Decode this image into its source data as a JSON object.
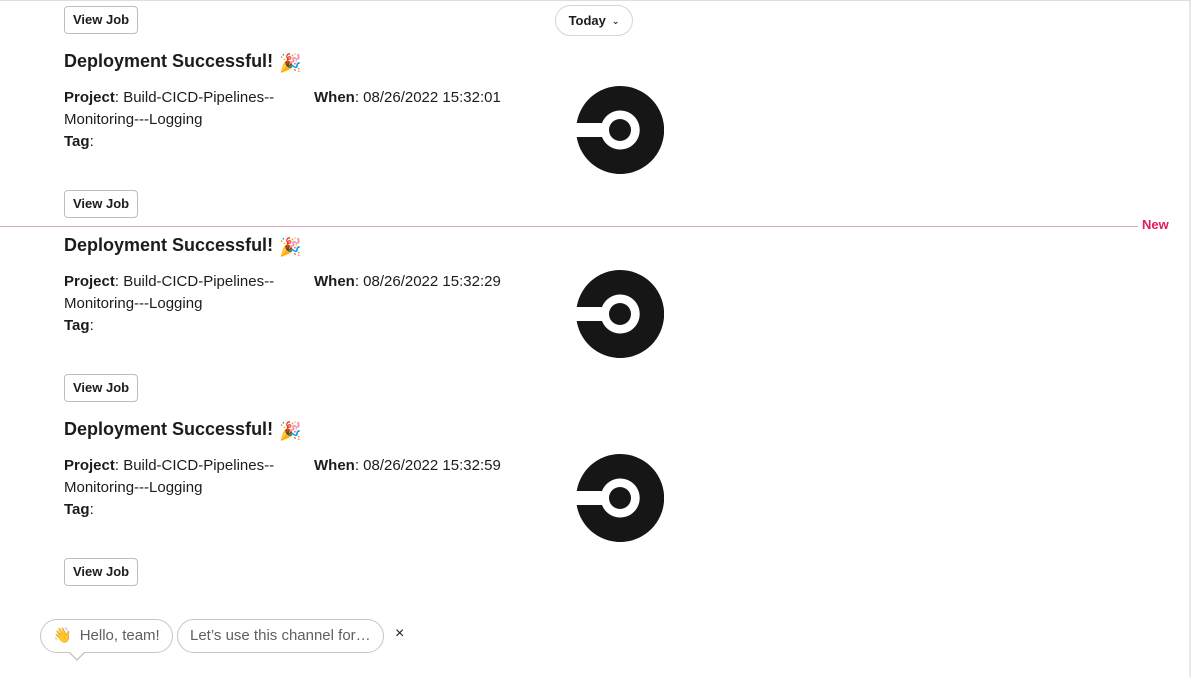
{
  "top": {
    "view_job_label": "View Job",
    "date_pill_label": "Today"
  },
  "messages": [
    {
      "title": "Deployment Successful!",
      "emoji": "🎉",
      "project_label": "Project",
      "project_value": "Build-CICD-Pipelines--Monitoring---Logging",
      "tag_label": "Tag",
      "tag_value": "",
      "when_label": "When",
      "when_value": "08/26/2022 15:32:01",
      "button_label": "View Job"
    },
    {
      "title": "Deployment Successful!",
      "emoji": "🎉",
      "project_label": "Project",
      "project_value": "Build-CICD-Pipelines--Monitoring---Logging",
      "tag_label": "Tag",
      "tag_value": "",
      "when_label": "When",
      "when_value": "08/26/2022 15:32:29",
      "button_label": "View Job"
    },
    {
      "title": "Deployment Successful!",
      "emoji": "🎉",
      "project_label": "Project",
      "project_value": "Build-CICD-Pipelines--Monitoring---Logging",
      "tag_label": "Tag",
      "tag_value": "",
      "when_label": "When",
      "when_value": "08/26/2022 15:32:59",
      "button_label": "View Job"
    }
  ],
  "new_divider": {
    "label": "New",
    "color": "#e01e5a"
  },
  "suggestions": {
    "hello_emoji": "👋",
    "hello_label": "Hello, team!",
    "channel_label": "Let’s use this channel for…",
    "close_symbol": "×"
  },
  "icons": {
    "logo": "circleci-logo-icon",
    "chevron": "chevron-down-icon",
    "close": "close-icon"
  }
}
